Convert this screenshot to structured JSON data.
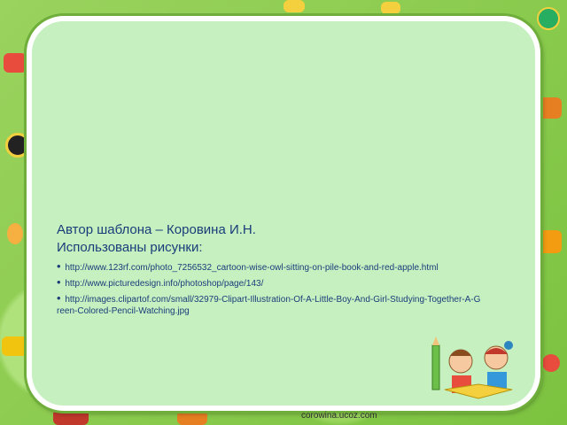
{
  "credits": {
    "author": "Автор шаблона – Коровина И.Н.",
    "used_label": "Использованы рисунки:",
    "links": [
      "http://www.123rf.com/photo_7256532_cartoon-wise-owl-sitting-on-pile-book-and-red-apple.html",
      "http://www.picturedesign.info/photoshop/page/143/",
      "http://images.clipartof.com/small/32979-Clipart-Illustration-Of-A-Little-Boy-And-Girl-Studying-Together-A-Green-Colored-Pencil-Watching.jpg"
    ]
  },
  "footer": {
    "site": "corowina.ucoz.com"
  },
  "colors": {
    "background": "#8fd14f",
    "card": "#c6f0c0",
    "text": "#1a3d7a"
  },
  "icons": [
    "toy-car-icon",
    "ball-icon",
    "kids-reading-icon"
  ]
}
